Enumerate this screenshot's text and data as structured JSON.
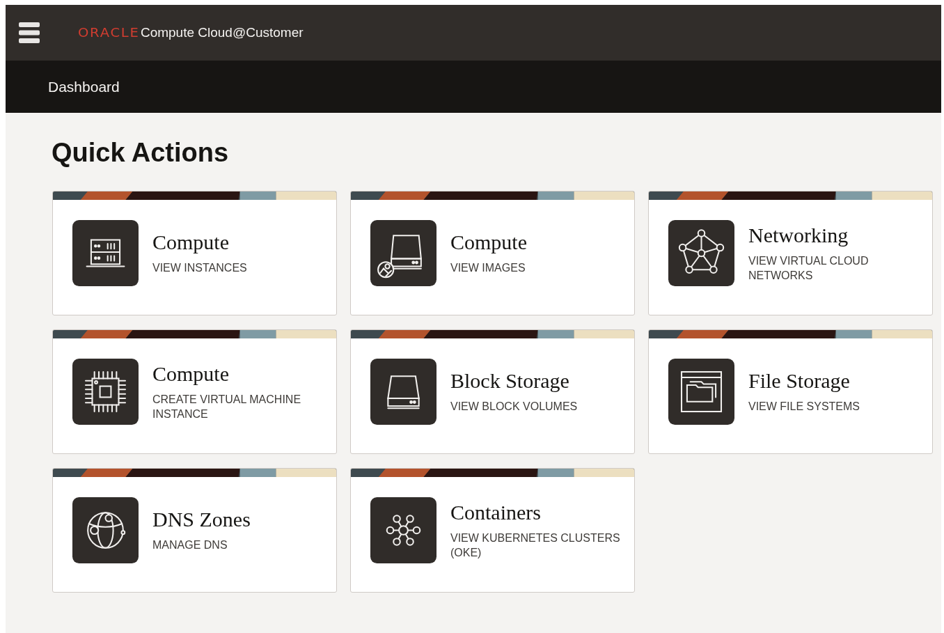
{
  "header": {
    "brand": "ORACLE",
    "product": "Compute Cloud@Customer"
  },
  "breadcrumb": "Dashboard",
  "section_title": "Quick Actions",
  "cards": [
    {
      "kind": "server",
      "title": "Compute",
      "action": "VIEW INSTANCES"
    },
    {
      "kind": "image-drive",
      "title": "Compute",
      "action": "VIEW IMAGES"
    },
    {
      "kind": "network",
      "title": "Networking",
      "action": "VIEW VIRTUAL CLOUD NETWORKS"
    },
    {
      "kind": "chip",
      "title": "Compute",
      "action": "CREATE VIRTUAL MACHINE INSTANCE"
    },
    {
      "kind": "drive",
      "title": "Block Storage",
      "action": "VIEW BLOCK VOLUMES"
    },
    {
      "kind": "folder",
      "title": "File Storage",
      "action": "VIEW FILE SYSTEMS"
    },
    {
      "kind": "globe",
      "title": "DNS Zones",
      "action": "MANAGE DNS"
    },
    {
      "kind": "cluster",
      "title": "Containers",
      "action": "VIEW KUBERNETES CLUSTERS (OKE)"
    }
  ]
}
